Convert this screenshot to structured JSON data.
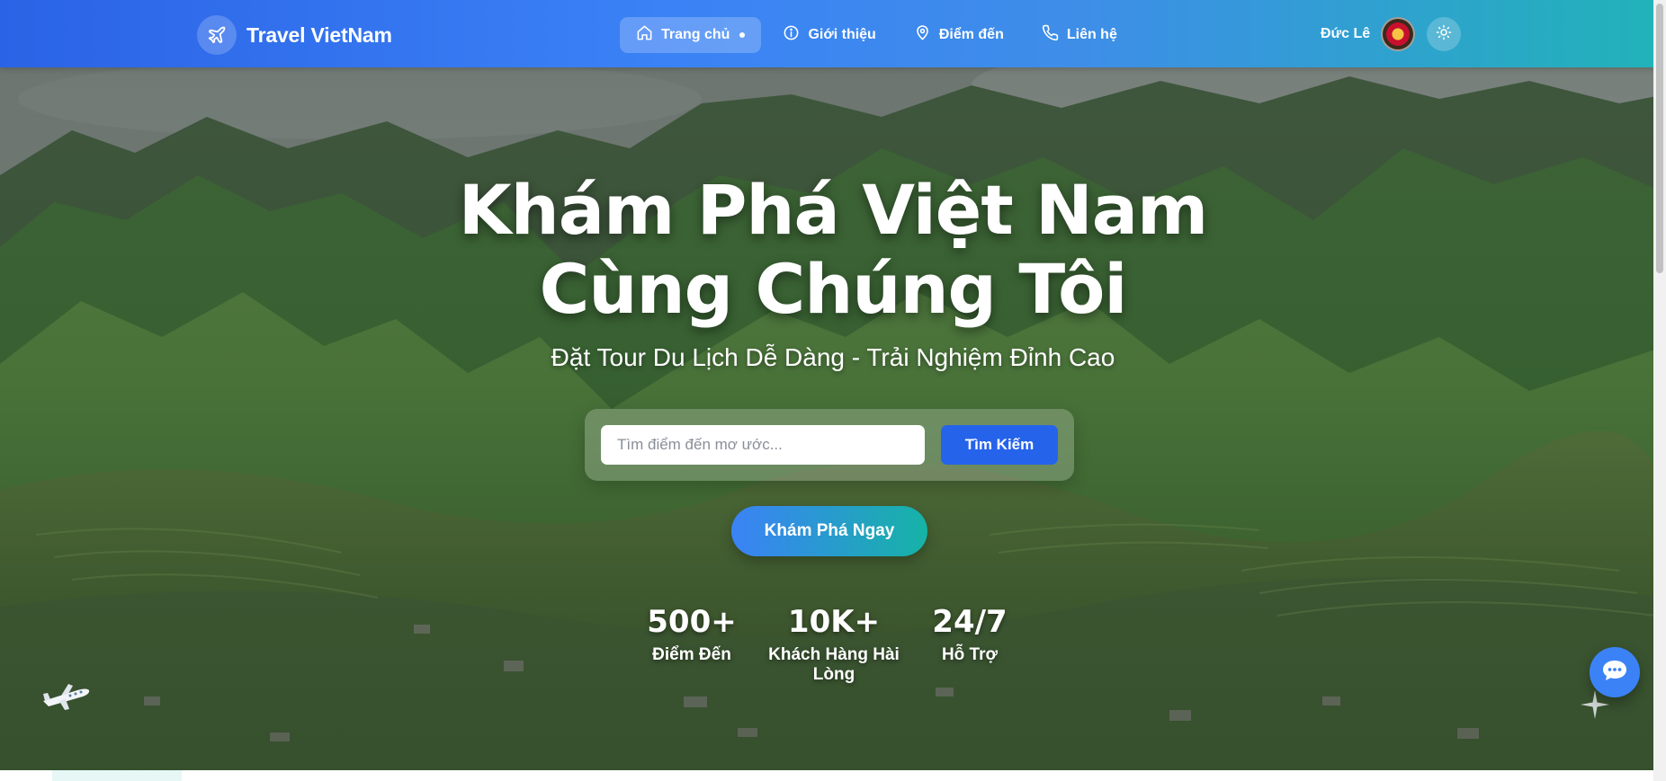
{
  "brand": {
    "name": "Travel VietNam",
    "icon": "plane-icon"
  },
  "nav": {
    "items": [
      {
        "label": "Trang chủ",
        "icon": "home-icon",
        "active": true
      },
      {
        "label": "Giới thiệu",
        "icon": "info-icon",
        "active": false
      },
      {
        "label": "Điểm đến",
        "icon": "map-pin-icon",
        "active": false
      },
      {
        "label": "Liên hệ",
        "icon": "phone-icon",
        "active": false
      }
    ]
  },
  "user": {
    "name": "Đức Lê",
    "avatar_icon": "team-crest-avatar"
  },
  "theme_toggle": {
    "icon": "sun-icon"
  },
  "hero": {
    "title_line1": "Khám Phá Việt Nam",
    "title_line2": "Cùng Chúng Tôi",
    "subtitle": "Đặt Tour Du Lịch Dễ Dàng - Trải Nghiệm Đỉnh Cao",
    "search_placeholder": "Tìm điểm đến mơ ước...",
    "search_value": "",
    "search_button": "Tìm Kiếm",
    "cta_button": "Khám Phá Ngay"
  },
  "stats": [
    {
      "value": "500+",
      "label": "Điểm Đến"
    },
    {
      "value": "10K+",
      "label": "Khách Hàng Hài Lòng"
    },
    {
      "value": "24/7",
      "label": "Hỗ Trợ"
    }
  ],
  "chat": {
    "icon": "chat-bubble-icon"
  },
  "colors": {
    "primary": "#2563eb",
    "nav_gradient_start": "#2b63e6",
    "nav_gradient_end": "#21b3b8",
    "cta_gradient_end": "#16b3a6"
  }
}
